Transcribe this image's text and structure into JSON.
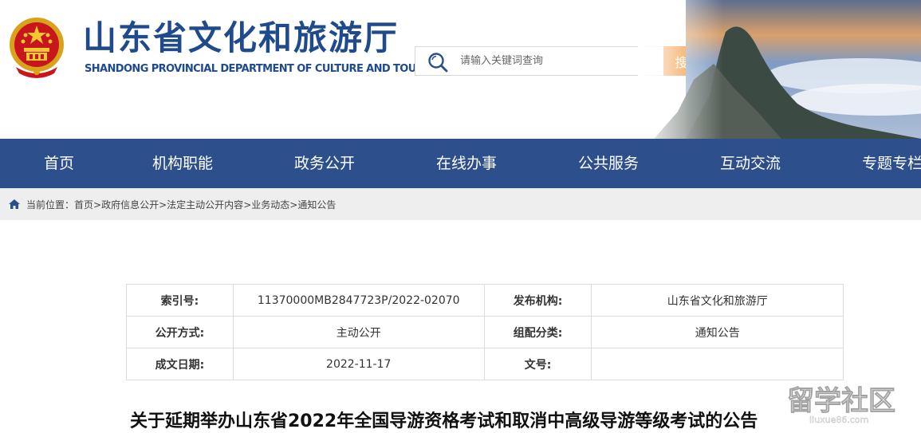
{
  "header": {
    "title_cn": "山东省文化和旅游厅",
    "title_en": "SHANDONG PROVINCIAL DEPARTMENT OF CULTURE AND TOURISM",
    "search": {
      "placeholder": "请输入关键词查询",
      "value": "",
      "button_label": "搜 索"
    }
  },
  "nav": {
    "items": [
      "首页",
      "机构职能",
      "政务公开",
      "在线办事",
      "公共服务",
      "互动交流",
      "专题专栏"
    ]
  },
  "breadcrumb": {
    "label": "当前位置：",
    "items": [
      "首页",
      "政府信息公开",
      "法定主动公开内容",
      "业务动态",
      "通知公告"
    ],
    "separator": ">"
  },
  "meta": {
    "rows": [
      [
        {
          "label": "索引号:",
          "value": "11370000MB2847723P/2022-02070"
        },
        {
          "label": "发布机构:",
          "value": "山东省文化和旅游厅"
        }
      ],
      [
        {
          "label": "公开方式:",
          "value": "主动公开"
        },
        {
          "label": "组配分类:",
          "value": "通知公告"
        }
      ],
      [
        {
          "label": "成文日期:",
          "value": "2022-11-17"
        },
        {
          "label": "文号:",
          "value": ""
        }
      ]
    ]
  },
  "article": {
    "title": "关于延期举办山东省2022年全国导游资格考试和取消中高级导游等级考试的公告"
  },
  "watermark": {
    "text_cn": "留学社区",
    "text_en": "liuxue86.com"
  },
  "colors": {
    "brand_blue": "#2d4f8c",
    "title_blue": "#1f4a8c",
    "search_orange": "#f08519"
  }
}
